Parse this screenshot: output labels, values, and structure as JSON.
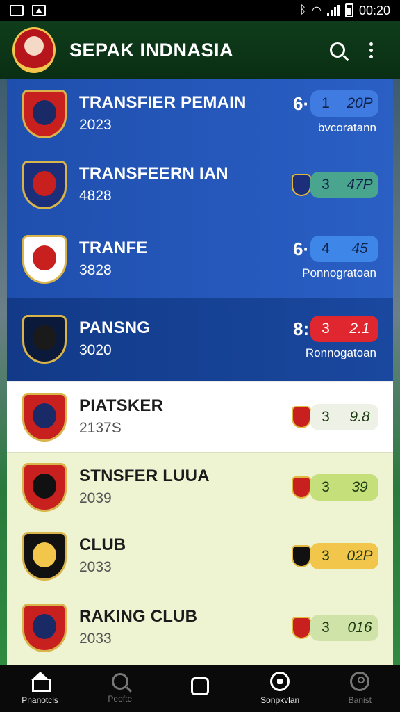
{
  "status_bar": {
    "time": "00:20",
    "left_icons": [
      "notification-icon",
      "image-icon"
    ],
    "right_icons": [
      "bluetooth-icon",
      "wifi-icon",
      "signal-icon",
      "battery-icon"
    ]
  },
  "app_bar": {
    "title": "SEPAK INDNASIA",
    "actions": [
      "search-icon",
      "more-vert-icon"
    ]
  },
  "rows": [
    {
      "name": "TRANSFIER PEMAIN",
      "year": "2023",
      "rank": "6·",
      "pill_left": "1",
      "pill_right": "20P",
      "pill_color": "#3f7be0",
      "sub": "bvcoratann",
      "style": "blue"
    },
    {
      "name": "TRANSFEERN IAN",
      "year": "4828",
      "rank": "",
      "pill_left": "3",
      "pill_right": "47P",
      "pill_color": "#4aa58e",
      "sub": "",
      "style": "blue"
    },
    {
      "name": "TRANFE",
      "year": "3828",
      "rank": "6·",
      "pill_left": "4",
      "pill_right": "45",
      "pill_color": "#3e86e8",
      "sub": "Ponnogratoan",
      "style": "blue"
    },
    {
      "name": "PANSNG",
      "year": "3020",
      "rank": "8:",
      "pill_left": "3",
      "pill_right": "2.1",
      "pill_color": "#e0262e",
      "sub": "Ronnogatoan",
      "style": "darkblue"
    },
    {
      "name": "PIATSKER",
      "year": "2137S",
      "rank": "",
      "pill_left": "3",
      "pill_right": "9.8",
      "pill_color": "#eef2e6",
      "sub": "",
      "style": "white"
    },
    {
      "name": "STNSFER LUUA",
      "year": "2039",
      "rank": "",
      "pill_left": "3",
      "pill_right": "39",
      "pill_color": "#c5e07a",
      "sub": "",
      "style": "light"
    },
    {
      "name": "CLUB",
      "year": "2033",
      "rank": "",
      "pill_left": "3",
      "pill_right": "02P",
      "pill_color": "#f2c64b",
      "sub": "",
      "style": "light"
    },
    {
      "name": "RAKING CLUB",
      "year": "2033",
      "rank": "",
      "pill_left": "3",
      "pill_right": "016",
      "pill_color": "#cfe3a8",
      "sub": "",
      "style": "light"
    }
  ],
  "bottom_nav": [
    {
      "label": "Pnanotcls",
      "icon": "home-icon",
      "active": true
    },
    {
      "label": "Peofte",
      "icon": "search-icon",
      "active": false
    },
    {
      "label": "",
      "icon": "square-icon",
      "active": true
    },
    {
      "label": "Sonpkvlan",
      "icon": "football-icon",
      "active": true
    },
    {
      "label": "Banist",
      "icon": "profile-icon",
      "active": false
    }
  ]
}
